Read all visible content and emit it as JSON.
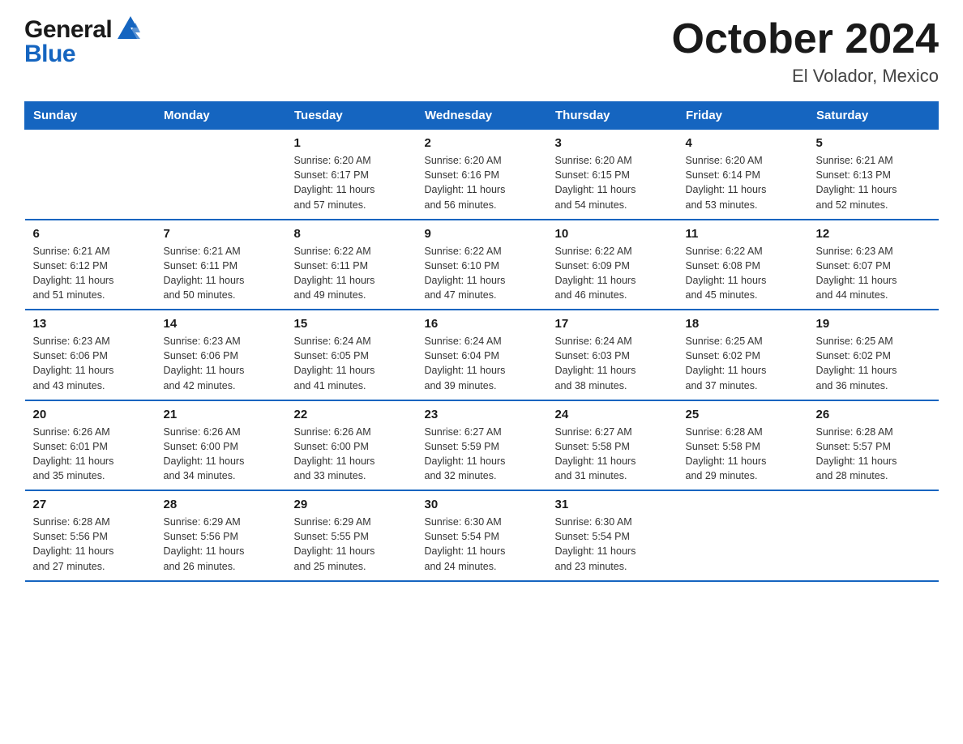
{
  "logo": {
    "general": "General",
    "blue": "Blue"
  },
  "title": {
    "month_year": "October 2024",
    "location": "El Volador, Mexico"
  },
  "weekdays": [
    "Sunday",
    "Monday",
    "Tuesday",
    "Wednesday",
    "Thursday",
    "Friday",
    "Saturday"
  ],
  "weeks": [
    [
      {
        "day": "",
        "info": ""
      },
      {
        "day": "",
        "info": ""
      },
      {
        "day": "1",
        "info": "Sunrise: 6:20 AM\nSunset: 6:17 PM\nDaylight: 11 hours\nand 57 minutes."
      },
      {
        "day": "2",
        "info": "Sunrise: 6:20 AM\nSunset: 6:16 PM\nDaylight: 11 hours\nand 56 minutes."
      },
      {
        "day": "3",
        "info": "Sunrise: 6:20 AM\nSunset: 6:15 PM\nDaylight: 11 hours\nand 54 minutes."
      },
      {
        "day": "4",
        "info": "Sunrise: 6:20 AM\nSunset: 6:14 PM\nDaylight: 11 hours\nand 53 minutes."
      },
      {
        "day": "5",
        "info": "Sunrise: 6:21 AM\nSunset: 6:13 PM\nDaylight: 11 hours\nand 52 minutes."
      }
    ],
    [
      {
        "day": "6",
        "info": "Sunrise: 6:21 AM\nSunset: 6:12 PM\nDaylight: 11 hours\nand 51 minutes."
      },
      {
        "day": "7",
        "info": "Sunrise: 6:21 AM\nSunset: 6:11 PM\nDaylight: 11 hours\nand 50 minutes."
      },
      {
        "day": "8",
        "info": "Sunrise: 6:22 AM\nSunset: 6:11 PM\nDaylight: 11 hours\nand 49 minutes."
      },
      {
        "day": "9",
        "info": "Sunrise: 6:22 AM\nSunset: 6:10 PM\nDaylight: 11 hours\nand 47 minutes."
      },
      {
        "day": "10",
        "info": "Sunrise: 6:22 AM\nSunset: 6:09 PM\nDaylight: 11 hours\nand 46 minutes."
      },
      {
        "day": "11",
        "info": "Sunrise: 6:22 AM\nSunset: 6:08 PM\nDaylight: 11 hours\nand 45 minutes."
      },
      {
        "day": "12",
        "info": "Sunrise: 6:23 AM\nSunset: 6:07 PM\nDaylight: 11 hours\nand 44 minutes."
      }
    ],
    [
      {
        "day": "13",
        "info": "Sunrise: 6:23 AM\nSunset: 6:06 PM\nDaylight: 11 hours\nand 43 minutes."
      },
      {
        "day": "14",
        "info": "Sunrise: 6:23 AM\nSunset: 6:06 PM\nDaylight: 11 hours\nand 42 minutes."
      },
      {
        "day": "15",
        "info": "Sunrise: 6:24 AM\nSunset: 6:05 PM\nDaylight: 11 hours\nand 41 minutes."
      },
      {
        "day": "16",
        "info": "Sunrise: 6:24 AM\nSunset: 6:04 PM\nDaylight: 11 hours\nand 39 minutes."
      },
      {
        "day": "17",
        "info": "Sunrise: 6:24 AM\nSunset: 6:03 PM\nDaylight: 11 hours\nand 38 minutes."
      },
      {
        "day": "18",
        "info": "Sunrise: 6:25 AM\nSunset: 6:02 PM\nDaylight: 11 hours\nand 37 minutes."
      },
      {
        "day": "19",
        "info": "Sunrise: 6:25 AM\nSunset: 6:02 PM\nDaylight: 11 hours\nand 36 minutes."
      }
    ],
    [
      {
        "day": "20",
        "info": "Sunrise: 6:26 AM\nSunset: 6:01 PM\nDaylight: 11 hours\nand 35 minutes."
      },
      {
        "day": "21",
        "info": "Sunrise: 6:26 AM\nSunset: 6:00 PM\nDaylight: 11 hours\nand 34 minutes."
      },
      {
        "day": "22",
        "info": "Sunrise: 6:26 AM\nSunset: 6:00 PM\nDaylight: 11 hours\nand 33 minutes."
      },
      {
        "day": "23",
        "info": "Sunrise: 6:27 AM\nSunset: 5:59 PM\nDaylight: 11 hours\nand 32 minutes."
      },
      {
        "day": "24",
        "info": "Sunrise: 6:27 AM\nSunset: 5:58 PM\nDaylight: 11 hours\nand 31 minutes."
      },
      {
        "day": "25",
        "info": "Sunrise: 6:28 AM\nSunset: 5:58 PM\nDaylight: 11 hours\nand 29 minutes."
      },
      {
        "day": "26",
        "info": "Sunrise: 6:28 AM\nSunset: 5:57 PM\nDaylight: 11 hours\nand 28 minutes."
      }
    ],
    [
      {
        "day": "27",
        "info": "Sunrise: 6:28 AM\nSunset: 5:56 PM\nDaylight: 11 hours\nand 27 minutes."
      },
      {
        "day": "28",
        "info": "Sunrise: 6:29 AM\nSunset: 5:56 PM\nDaylight: 11 hours\nand 26 minutes."
      },
      {
        "day": "29",
        "info": "Sunrise: 6:29 AM\nSunset: 5:55 PM\nDaylight: 11 hours\nand 25 minutes."
      },
      {
        "day": "30",
        "info": "Sunrise: 6:30 AM\nSunset: 5:54 PM\nDaylight: 11 hours\nand 24 minutes."
      },
      {
        "day": "31",
        "info": "Sunrise: 6:30 AM\nSunset: 5:54 PM\nDaylight: 11 hours\nand 23 minutes."
      },
      {
        "day": "",
        "info": ""
      },
      {
        "day": "",
        "info": ""
      }
    ]
  ]
}
